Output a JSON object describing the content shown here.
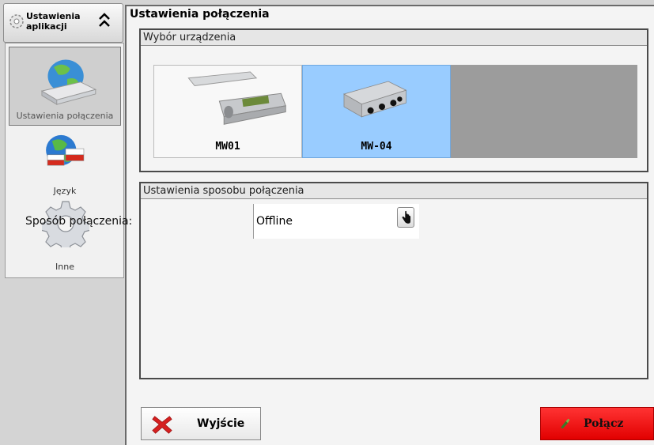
{
  "nav": {
    "header_title_line1": "Ustawienia",
    "header_title_line2": "aplikacji",
    "items": [
      {
        "label": "Ustawienia połączenia",
        "icon": "network-router-icon",
        "selected": true
      },
      {
        "label": "Język",
        "icon": "globe-flag-icon",
        "selected": false
      },
      {
        "label": "Inne",
        "icon": "gear-icon",
        "selected": false
      }
    ]
  },
  "main": {
    "title": "Ustawienia połączenia",
    "device_group": {
      "title": "Wybór urządzenia",
      "devices": [
        {
          "label": "MW01",
          "selected": false
        },
        {
          "label": "MW-04",
          "selected": true
        }
      ]
    },
    "connection_group": {
      "title": "Ustawienia sposobu połączenia",
      "field_label": "Sposób połączenia:",
      "field_value": "Offline"
    }
  },
  "buttons": {
    "exit_label": "Wyjście",
    "connect_label": "Połącz"
  },
  "colors": {
    "selected_device": "#99ccff",
    "connect_button": "#ff2020",
    "exit_icon": "#d62020"
  }
}
